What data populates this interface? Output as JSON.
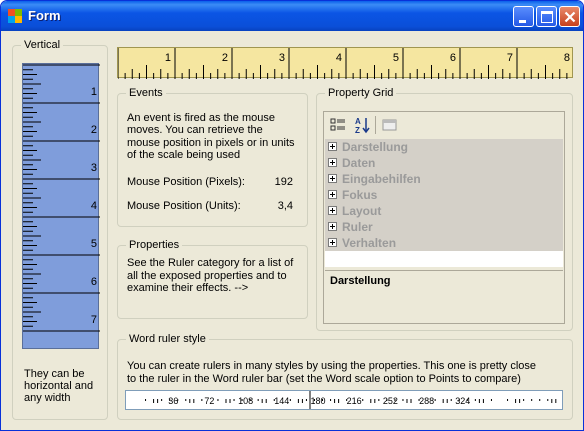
{
  "window": {
    "title": "Form"
  },
  "vertical_group": {
    "legend": "Vertical",
    "ruler_labels": [
      "1",
      "2",
      "3",
      "4",
      "5",
      "6",
      "7"
    ],
    "caption_lines": [
      "They can be",
      "horizontal and",
      "any width"
    ]
  },
  "top_ruler": {
    "labels": [
      "1",
      "2",
      "3",
      "4",
      "5",
      "6",
      "7",
      "8"
    ]
  },
  "events_group": {
    "legend": "Events",
    "description_lines": [
      "An event is fired as the mouse",
      "moves.  You can retrieve the",
      "mouse position in pixels or in units",
      "of the scale being used"
    ],
    "pixels_label": "Mouse Position (Pixels):",
    "pixels_value": "192",
    "units_label": "Mouse Position (Units):",
    "units_value": "3,4"
  },
  "properties_group": {
    "legend": "Properties",
    "description_lines": [
      "See the Ruler category for a list of",
      "all the exposed properties and to",
      "examine their effects. -->"
    ]
  },
  "property_grid_group": {
    "legend": "Property Grid",
    "toolbar_icons": [
      "categorized-icon",
      "alphabetical-icon",
      "property-pages-icon"
    ],
    "categories": [
      "Darstellung",
      "Daten",
      "Eingabehilfen",
      "Fokus",
      "Layout",
      "Ruler",
      "Verhalten"
    ],
    "description_title": "Darstellung"
  },
  "word_group": {
    "legend": "Word ruler style",
    "description_lines": [
      "You can create rulers in many styles by using the properties.  This one is pretty close",
      "to the ruler in the Word ruler bar (set the Word scale option to Points to compare)"
    ],
    "ruler_labels": [
      "36",
      "72",
      "108",
      "144",
      "180",
      "216",
      "252",
      "288",
      "324"
    ]
  },
  "colors": {
    "title_bar": "#0A55E5",
    "vertical_ruler": "#7F9DDB",
    "horizontal_ruler": "#F5E6A0",
    "window_face": "#ECE9D8"
  }
}
